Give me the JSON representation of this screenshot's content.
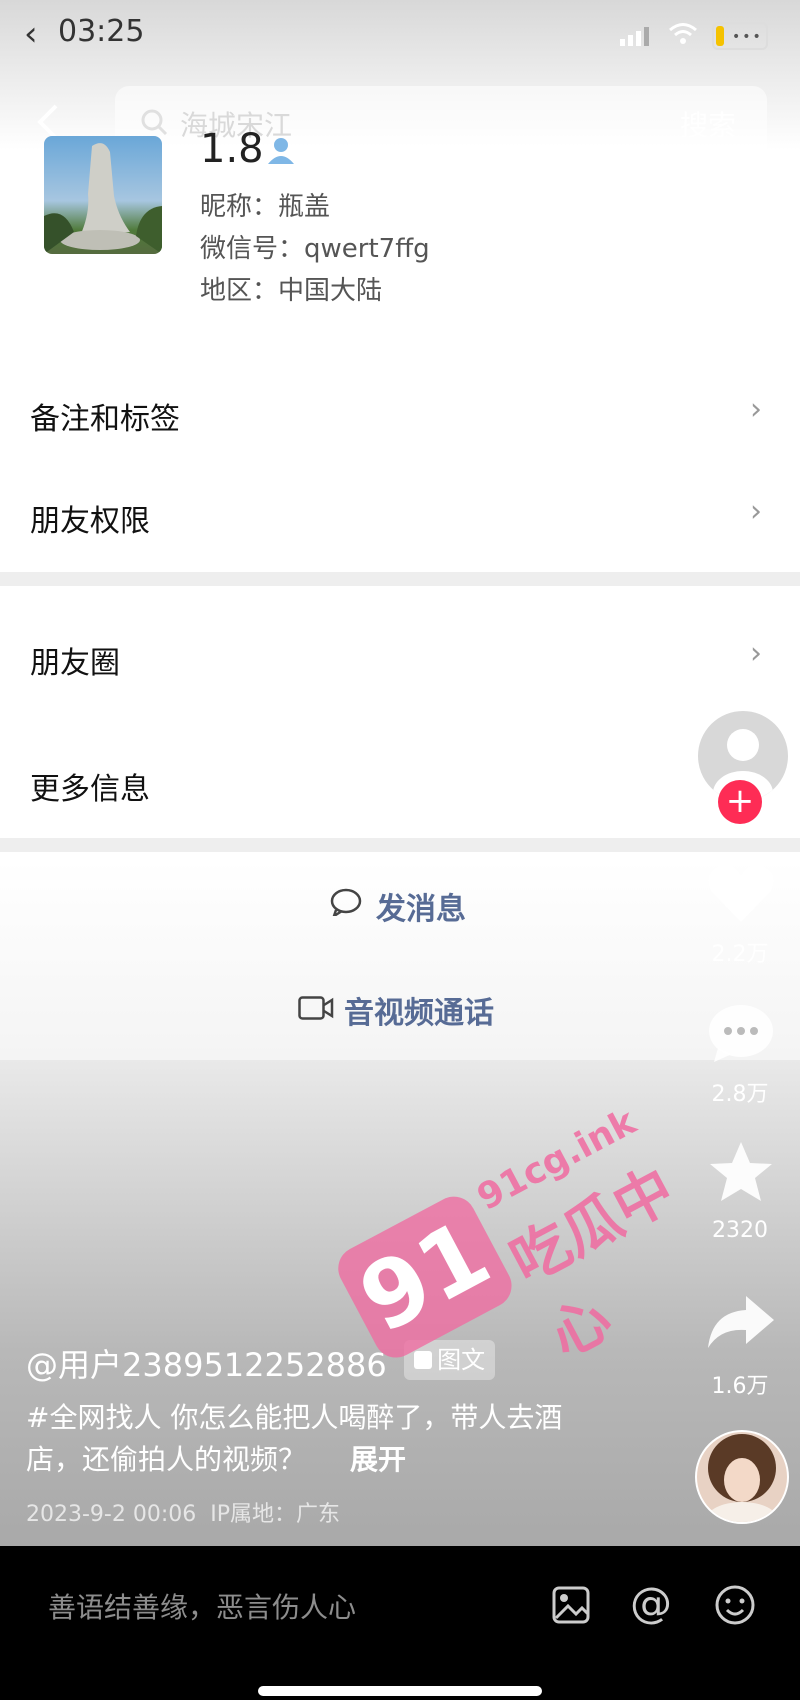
{
  "status_bar": {
    "time": "03:25"
  },
  "search": {
    "placeholder": "海城宋江",
    "submit_label": "搜索"
  },
  "profile": {
    "name": "1.8",
    "nickname": "昵称：瓶盖",
    "wechat_id": "微信号：qwert7ffg",
    "region": "地区：中国大陆"
  },
  "menu": {
    "remarks": "备注和标签",
    "permissions": "朋友权限",
    "moments": "朋友圈",
    "more_info": "更多信息"
  },
  "actions": {
    "message": "发消息",
    "call": "音视频通话"
  },
  "side_stats": {
    "likes": "2.2万",
    "comments": "2.8万",
    "favorites": "2320",
    "shares": "1.6万"
  },
  "post": {
    "username": "@用户2389512252886",
    "tag": "图文",
    "caption_line1": "#全网找人 你怎么能把人喝醉了，带人去酒",
    "caption_line2": "店，还偷拍人的视频？",
    "expand": "展开",
    "meta": "2023-9-2 00:06  IP属地：广东"
  },
  "comment_bar": {
    "placeholder": "善语结善缘，恶言伤人心"
  },
  "watermark": {
    "number": "91",
    "site": "91cg.ink",
    "brand": "吃瓜中心"
  },
  "colors": {
    "accent_red": "#fe2c55",
    "link_blue": "#576b95",
    "watermark_pink": "#f06aa0"
  }
}
